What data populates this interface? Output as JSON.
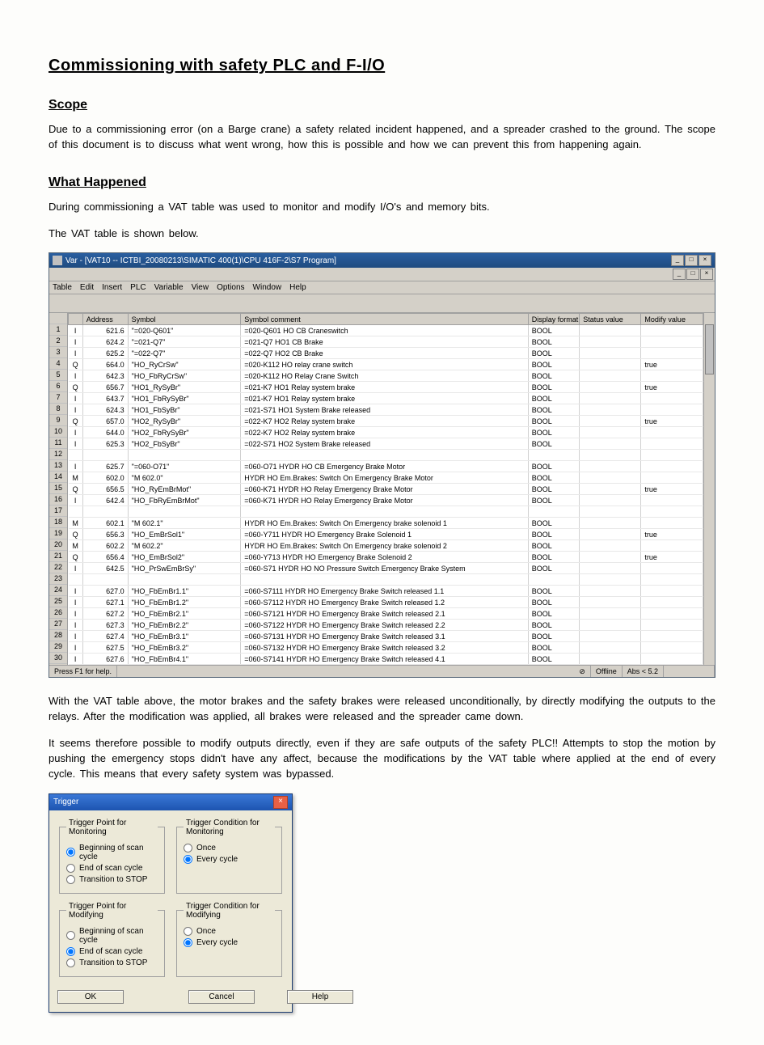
{
  "doc": {
    "title": "Commissioning with safety PLC and F-I/O",
    "h_scope": "Scope",
    "p_scope": "Due to a commissioning error (on a Barge crane) a safety related incident happened, and a spreader crashed to the ground. The scope of this document is to discuss what went wrong, how this is possible and how we can prevent this from happening again.",
    "h_what": "What Happened",
    "p_what1": "During commissioning a VAT table was used to monitor and modify I/O's and memory bits.",
    "p_what1b": "The VAT table is shown below.",
    "p_after1": "With the VAT table above, the motor brakes and the safety brakes were released unconditionally, by directly modifying the outputs to the relays. After the modification was applied, all brakes were released and the spreader came down.",
    "p_after2": "It seems therefore possible to modify outputs directly, even if they are safe outputs of the safety PLC!! Attempts to stop the motion by pushing the emergency stops didn't have any affect, because the modifications by the VAT table where applied at the end of every cycle. This means that every safety system was bypassed."
  },
  "vat": {
    "title": "Var - [VAT10 -- ICTBI_20080213\\SIMATIC 400(1)\\CPU 416F-2\\S7 Program]",
    "menus": [
      "Table",
      "Edit",
      "Insert",
      "PLC",
      "Variable",
      "View",
      "Options",
      "Window",
      "Help"
    ],
    "columns": [
      "",
      "Address",
      "Symbol",
      "Symbol comment",
      "Display format",
      "Status value",
      "Modify value"
    ],
    "rows": [
      {
        "n": "1",
        "t": "I",
        "addr": "621.6",
        "sym": "\"=020-Q601\"",
        "comm": "=020-Q601 HO CB Craneswitch",
        "disp": "BOOL",
        "stat": "",
        "mod": ""
      },
      {
        "n": "2",
        "t": "I",
        "addr": "624.2",
        "sym": "\"=021-Q7\"",
        "comm": "=021-Q7 HO1 CB Brake",
        "disp": "BOOL",
        "stat": "",
        "mod": ""
      },
      {
        "n": "3",
        "t": "I",
        "addr": "625.2",
        "sym": "\"=022-Q7\"",
        "comm": "=022-Q7 HO2 CB Brake",
        "disp": "BOOL",
        "stat": "",
        "mod": ""
      },
      {
        "n": "4",
        "t": "Q",
        "addr": "664.0",
        "sym": "\"HO_RyCrSw\"",
        "comm": "=020-K112 HO relay crane switch",
        "disp": "BOOL",
        "stat": "",
        "mod": "true"
      },
      {
        "n": "5",
        "t": "I",
        "addr": "642.3",
        "sym": "\"HO_FbRyCrSw\"",
        "comm": "=020-K112 HO Relay Crane Switch",
        "disp": "BOOL",
        "stat": "",
        "mod": ""
      },
      {
        "n": "6",
        "t": "Q",
        "addr": "656.7",
        "sym": "\"HO1_RySyBr\"",
        "comm": "=021-K7 HO1 Relay system brake",
        "disp": "BOOL",
        "stat": "",
        "mod": "true"
      },
      {
        "n": "7",
        "t": "I",
        "addr": "643.7",
        "sym": "\"HO1_FbRySyBr\"",
        "comm": "=021-K7 HO1 Relay system brake",
        "disp": "BOOL",
        "stat": "",
        "mod": ""
      },
      {
        "n": "8",
        "t": "I",
        "addr": "624.3",
        "sym": "\"HO1_FbSyBr\"",
        "comm": "=021-S71 HO1 System Brake released",
        "disp": "BOOL",
        "stat": "",
        "mod": ""
      },
      {
        "n": "9",
        "t": "Q",
        "addr": "657.0",
        "sym": "\"HO2_RySyBr\"",
        "comm": "=022-K7 HO2 Relay system brake",
        "disp": "BOOL",
        "stat": "",
        "mod": "true"
      },
      {
        "n": "10",
        "t": "I",
        "addr": "644.0",
        "sym": "\"HO2_FbRySyBr\"",
        "comm": "=022-K7 HO2 Relay system brake",
        "disp": "BOOL",
        "stat": "",
        "mod": ""
      },
      {
        "n": "11",
        "t": "I",
        "addr": "625.3",
        "sym": "\"HO2_FbSyBr\"",
        "comm": "=022-S71 HO2 System Brake released",
        "disp": "BOOL",
        "stat": "",
        "mod": ""
      },
      {
        "n": "12",
        "t": "",
        "addr": "",
        "sym": "",
        "comm": "",
        "disp": "",
        "stat": "",
        "mod": ""
      },
      {
        "n": "13",
        "t": "I",
        "addr": "625.7",
        "sym": "\"=060-O71\"",
        "comm": "=060-O71 HYDR HO CB Emergency Brake Motor",
        "disp": "BOOL",
        "stat": "",
        "mod": ""
      },
      {
        "n": "14",
        "t": "M",
        "addr": "602.0",
        "sym": "\"M 602.0\"",
        "comm": "HYDR HO Em.Brakes: Switch On Emergency Brake Motor",
        "disp": "BOOL",
        "stat": "",
        "mod": ""
      },
      {
        "n": "15",
        "t": "Q",
        "addr": "656.5",
        "sym": "\"HO_RyEmBrMot\"",
        "comm": "=060-K71 HYDR HO Relay Emergency Brake Motor",
        "disp": "BOOL",
        "stat": "",
        "mod": "true"
      },
      {
        "n": "16",
        "t": "I",
        "addr": "642.4",
        "sym": "\"HO_FbRyEmBrMot\"",
        "comm": "=060-K71 HYDR HO Relay Emergency Brake Motor",
        "disp": "BOOL",
        "stat": "",
        "mod": ""
      },
      {
        "n": "17",
        "t": "",
        "addr": "",
        "sym": "",
        "comm": "",
        "disp": "",
        "stat": "",
        "mod": ""
      },
      {
        "n": "18",
        "t": "M",
        "addr": "602.1",
        "sym": "\"M 602.1\"",
        "comm": "HYDR HO Em.Brakes: Switch On Emergency brake solenoid 1",
        "disp": "BOOL",
        "stat": "",
        "mod": ""
      },
      {
        "n": "19",
        "t": "Q",
        "addr": "656.3",
        "sym": "\"HO_EmBrSol1\"",
        "comm": "=060-Y711 HYDR HO Emergency Brake Solenoid 1",
        "disp": "BOOL",
        "stat": "",
        "mod": "true"
      },
      {
        "n": "20",
        "t": "M",
        "addr": "602.2",
        "sym": "\"M 602.2\"",
        "comm": "HYDR HO Em.Brakes: Switch On Emergency brake solenoid 2",
        "disp": "BOOL",
        "stat": "",
        "mod": ""
      },
      {
        "n": "21",
        "t": "Q",
        "addr": "656.4",
        "sym": "\"HO_EmBrSol2\"",
        "comm": "=060-Y713 HYDR HO Emergency Brake Solenoid 2",
        "disp": "BOOL",
        "stat": "",
        "mod": "true"
      },
      {
        "n": "22",
        "t": "I",
        "addr": "642.5",
        "sym": "\"HO_PrSwEmBrSy\"",
        "comm": "=060-S71 HYDR HO NO Pressure Switch Emergency Brake System",
        "disp": "BOOL",
        "stat": "",
        "mod": ""
      },
      {
        "n": "23",
        "t": "",
        "addr": "",
        "sym": "",
        "comm": "",
        "disp": "",
        "stat": "",
        "mod": ""
      },
      {
        "n": "24",
        "t": "I",
        "addr": "627.0",
        "sym": "\"HO_FbEmBr1.1\"",
        "comm": "=060-S7111 HYDR HO Emergency Brake Switch released 1.1",
        "disp": "BOOL",
        "stat": "",
        "mod": ""
      },
      {
        "n": "25",
        "t": "I",
        "addr": "627.1",
        "sym": "\"HO_FbEmBr1.2\"",
        "comm": "=060-S7112 HYDR HO Emergency Brake Switch released 1.2",
        "disp": "BOOL",
        "stat": "",
        "mod": ""
      },
      {
        "n": "26",
        "t": "I",
        "addr": "627.2",
        "sym": "\"HO_FbEmBr2.1\"",
        "comm": "=060-S7121 HYDR HO Emergency Brake Switch released 2.1",
        "disp": "BOOL",
        "stat": "",
        "mod": ""
      },
      {
        "n": "27",
        "t": "I",
        "addr": "627.3",
        "sym": "\"HO_FbEmBr2.2\"",
        "comm": "=060-S7122 HYDR HO Emergency Brake Switch released 2.2",
        "disp": "BOOL",
        "stat": "",
        "mod": ""
      },
      {
        "n": "28",
        "t": "I",
        "addr": "627.4",
        "sym": "\"HO_FbEmBr3.1\"",
        "comm": "=060-S7131 HYDR HO Emergency Brake Switch released 3.1",
        "disp": "BOOL",
        "stat": "",
        "mod": ""
      },
      {
        "n": "29",
        "t": "I",
        "addr": "627.5",
        "sym": "\"HO_FbEmBr3.2\"",
        "comm": "=060-S7132 HYDR HO Emergency Brake Switch released 3.2",
        "disp": "BOOL",
        "stat": "",
        "mod": ""
      },
      {
        "n": "30",
        "t": "I",
        "addr": "627.6",
        "sym": "\"HO_FbEmBr4.1\"",
        "comm": "=060-S7141 HYDR HO Emergency Brake Switch released 4.1",
        "disp": "BOOL",
        "stat": "",
        "mod": ""
      }
    ],
    "status": {
      "help": "Press F1 for help.",
      "offline": "Offline",
      "abs": "Abs < 5.2"
    }
  },
  "dialog": {
    "title": "Trigger",
    "groups": {
      "g1": {
        "legend": "Trigger Point for Monitoring",
        "opts": [
          "Beginning of scan cycle",
          "End of scan cycle",
          "Transition to STOP"
        ],
        "sel": 0
      },
      "g2": {
        "legend": "Trigger Condition for Monitoring",
        "opts": [
          "Once",
          "Every cycle"
        ],
        "sel": 1
      },
      "g3": {
        "legend": "Trigger Point for Modifying",
        "opts": [
          "Beginning of scan cycle",
          "End of scan cycle",
          "Transition to STOP"
        ],
        "sel": 1
      },
      "g4": {
        "legend": "Trigger Condition for Modifying",
        "opts": [
          "Once",
          "Every cycle"
        ],
        "sel": 1
      }
    },
    "buttons": {
      "ok": "OK",
      "cancel": "Cancel",
      "help": "Help"
    }
  }
}
